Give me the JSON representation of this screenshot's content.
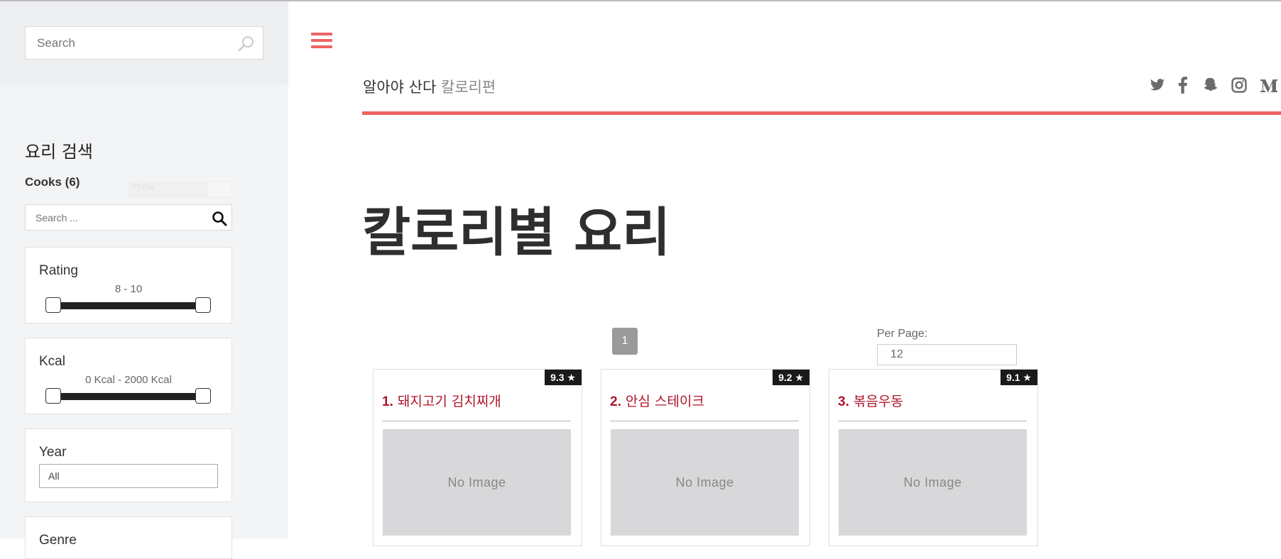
{
  "sidebar": {
    "search_placeholder": "Search",
    "section_title": "요리 검색",
    "cooks_label": "Cooks (6)",
    "cooks_progress_text": "77.0%",
    "cooks_progress_value": 0.77,
    "cook_search_placeholder": "Search ...",
    "rating": {
      "label": "Rating",
      "range_text": "8 - 10",
      "min": 8,
      "max": 10
    },
    "kcal": {
      "label": "Kcal",
      "range_text": "0 Kcal - 2000 Kcal",
      "min": 0,
      "max": 2000
    },
    "year": {
      "label": "Year",
      "selected": "All"
    },
    "genre": {
      "label": "Genre"
    }
  },
  "header": {
    "brand_dark": "알아야 산다",
    "brand_light": "칼로리편",
    "social_icons": [
      "twitter-icon",
      "facebook-icon",
      "snapchat-icon",
      "instagram-icon",
      "medium-icon"
    ],
    "accent_color": "#ee6363"
  },
  "main": {
    "page_title": "칼로리별 요리",
    "pagination": {
      "current_page": "1"
    },
    "per_page": {
      "label": "Per Page:",
      "value": "12"
    },
    "cards": [
      {
        "rank": "1.",
        "title": "돼지고기 김치찌개",
        "rating": "9.3",
        "image_text": "No Image"
      },
      {
        "rank": "2.",
        "title": "안심 스테이크",
        "rating": "9.2",
        "image_text": "No Image"
      },
      {
        "rank": "3.",
        "title": "볶음우동",
        "rating": "9.1",
        "image_text": "No Image"
      }
    ]
  }
}
